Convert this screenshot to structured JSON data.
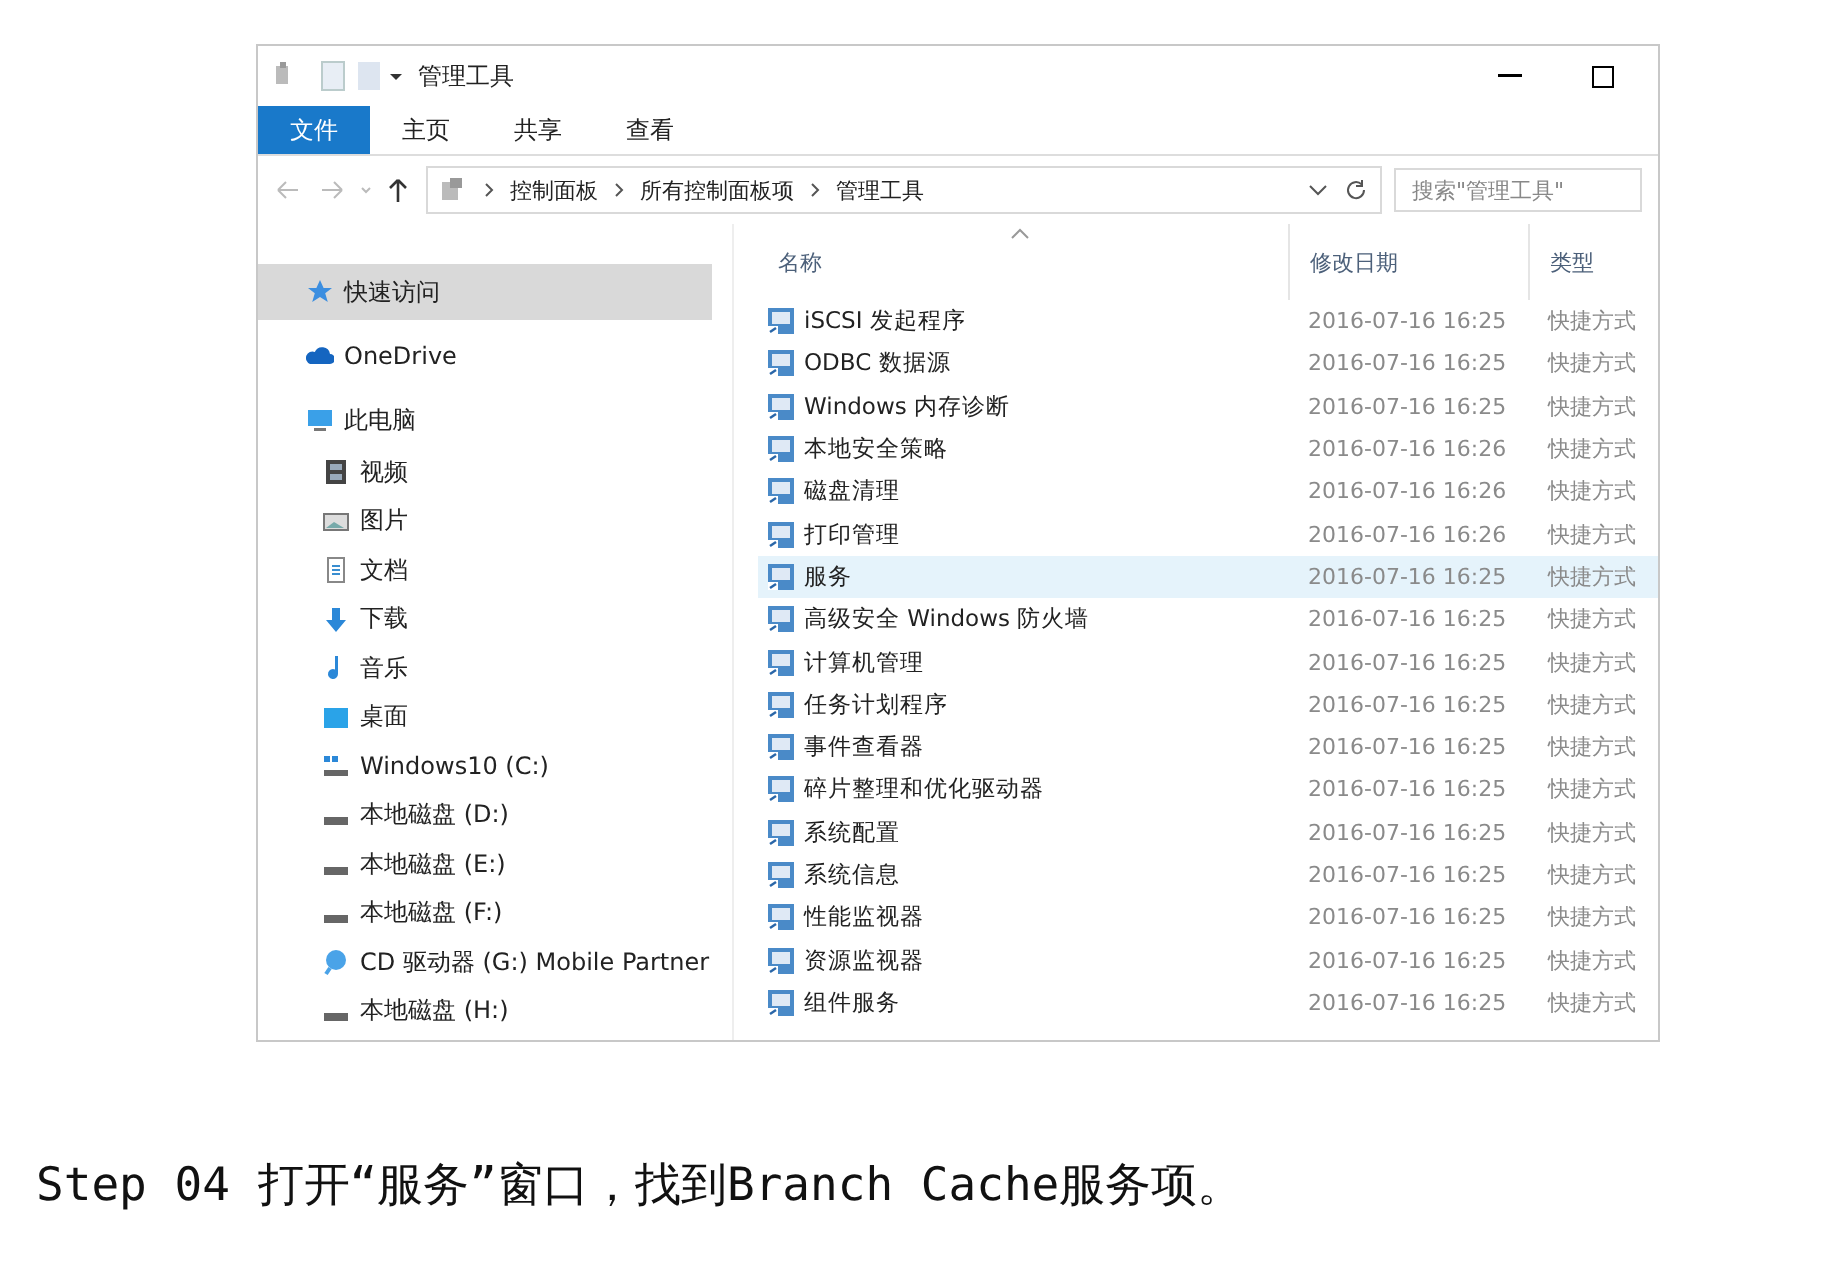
{
  "window": {
    "title": "管理工具"
  },
  "ribbon_tabs": [
    {
      "label": "文件",
      "selected": true
    },
    {
      "label": "主页",
      "selected": false
    },
    {
      "label": "共享",
      "selected": false
    },
    {
      "label": "查看",
      "selected": false
    }
  ],
  "address_bar": {
    "path": [
      "控制面板",
      "所有控制面板项",
      "管理工具"
    ]
  },
  "search": {
    "placeholder": "搜索\"管理工具\""
  },
  "sidebar": {
    "items": [
      {
        "label": "快速访问",
        "kind": "quick",
        "selected": true
      },
      {
        "label": "OneDrive",
        "kind": "cloud",
        "selected": false
      },
      {
        "label": "此电脑",
        "kind": "pc",
        "selected": false,
        "children": [
          {
            "label": "视频",
            "kind": "video",
            "selected": false
          },
          {
            "label": "图片",
            "kind": "picture",
            "selected": false
          },
          {
            "label": "文档",
            "kind": "document",
            "selected": false
          },
          {
            "label": "下载",
            "kind": "download",
            "selected": false
          },
          {
            "label": "音乐",
            "kind": "music",
            "selected": false
          },
          {
            "label": "桌面",
            "kind": "desktop",
            "selected": false
          },
          {
            "label": "Windows10 (C:)",
            "kind": "system",
            "selected": false
          },
          {
            "label": "本地磁盘 (D:)",
            "kind": "drive",
            "selected": false
          },
          {
            "label": "本地磁盘 (E:)",
            "kind": "drive",
            "selected": false
          },
          {
            "label": "本地磁盘 (F:)",
            "kind": "drive",
            "selected": false
          },
          {
            "label": "CD 驱动器 (G:) Mobile Partner",
            "kind": "cd",
            "selected": false
          },
          {
            "label": "本地磁盘 (H:)",
            "kind": "drive",
            "selected": false
          }
        ]
      }
    ]
  },
  "table": {
    "columns": [
      "名称",
      "修改日期",
      "类型"
    ],
    "rows": [
      {
        "name": "iSCSI 发起程序",
        "date": "2016-07-16 16:25",
        "type": "快捷方式",
        "selected": false
      },
      {
        "name": "ODBC 数据源",
        "date": "2016-07-16 16:25",
        "type": "快捷方式",
        "selected": false
      },
      {
        "name": "Windows 内存诊断",
        "date": "2016-07-16 16:25",
        "type": "快捷方式",
        "selected": false
      },
      {
        "name": "本地安全策略",
        "date": "2016-07-16 16:26",
        "type": "快捷方式",
        "selected": false
      },
      {
        "name": "磁盘清理",
        "date": "2016-07-16 16:26",
        "type": "快捷方式",
        "selected": false
      },
      {
        "name": "打印管理",
        "date": "2016-07-16 16:26",
        "type": "快捷方式",
        "selected": false
      },
      {
        "name": "服务",
        "date": "2016-07-16 16:25",
        "type": "快捷方式",
        "selected": true
      },
      {
        "name": "高级安全 Windows 防火墙",
        "date": "2016-07-16 16:25",
        "type": "快捷方式",
        "selected": false
      },
      {
        "name": "计算机管理",
        "date": "2016-07-16 16:25",
        "type": "快捷方式",
        "selected": false
      },
      {
        "name": "任务计划程序",
        "date": "2016-07-16 16:25",
        "type": "快捷方式",
        "selected": false
      },
      {
        "name": "事件查看器",
        "date": "2016-07-16 16:25",
        "type": "快捷方式",
        "selected": false
      },
      {
        "name": "碎片整理和优化驱动器",
        "date": "2016-07-16 16:25",
        "type": "快捷方式",
        "selected": false
      },
      {
        "name": "系统配置",
        "date": "2016-07-16 16:25",
        "type": "快捷方式",
        "selected": false
      },
      {
        "name": "系统信息",
        "date": "2016-07-16 16:25",
        "type": "快捷方式",
        "selected": false
      },
      {
        "name": "性能监视器",
        "date": "2016-07-16 16:25",
        "type": "快捷方式",
        "selected": false
      },
      {
        "name": "资源监视器",
        "date": "2016-07-16 16:25",
        "type": "快捷方式",
        "selected": false
      },
      {
        "name": "组件服务",
        "date": "2016-07-16 16:25",
        "type": "快捷方式",
        "selected": false
      }
    ]
  },
  "caption": "Step 04  打开“服务”窗口，找到Branch Cache服务项。"
}
